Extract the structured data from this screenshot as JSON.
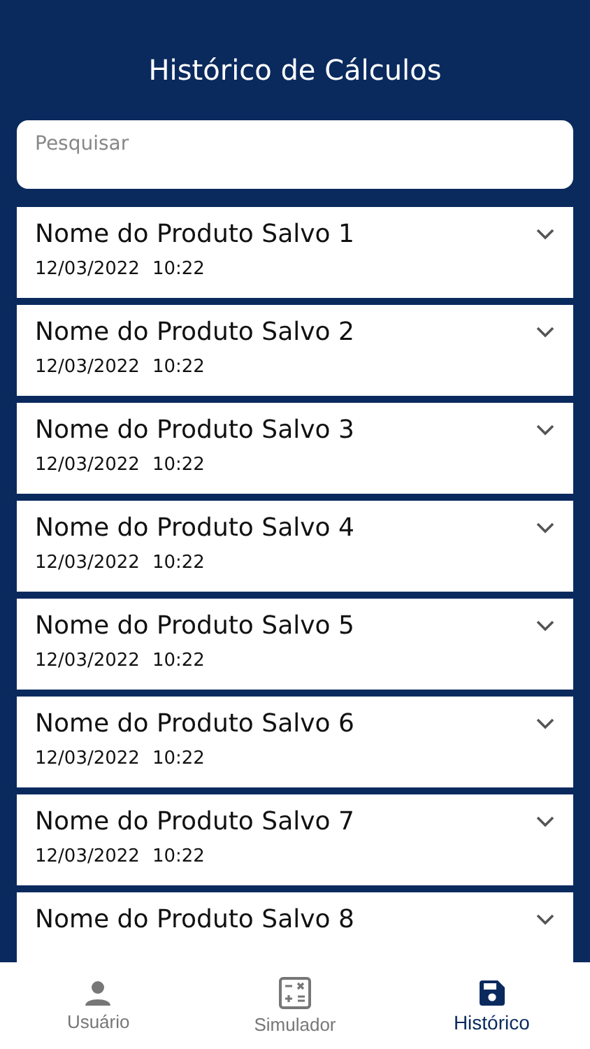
{
  "header": {
    "title": "Histórico de Cálculos"
  },
  "search": {
    "placeholder": "Pesquisar"
  },
  "items": [
    {
      "name": "Nome do Produto Salvo 1",
      "date": "12/03/2022",
      "time": "10:22",
      "expanded": false
    },
    {
      "name": "Nome do Produto Salvo 2",
      "date": "12/03/2022",
      "time": "10:22",
      "expanded": false
    },
    {
      "name": "Nome do Produto Salvo 3",
      "date": "12/03/2022",
      "time": "10:22",
      "expanded": false
    },
    {
      "name": "Nome do Produto Salvo 4",
      "date": "12/03/2022",
      "time": "10:22",
      "expanded": false
    },
    {
      "name": "Nome do Produto Salvo 5",
      "date": "12/03/2022",
      "time": "10:22",
      "expanded": false
    },
    {
      "name": "Nome do Produto Salvo 6",
      "date": "12/03/2022",
      "time": "10:22",
      "expanded": false
    },
    {
      "name": "Nome do Produto Salvo 7",
      "date": "12/03/2022",
      "time": "10:22",
      "expanded": false
    },
    {
      "name": "Nome do Produto Salvo 8",
      "expanded": false
    }
  ],
  "nav": [
    {
      "label": "Usuário",
      "kind": "user",
      "selected": false
    },
    {
      "label": "Simulador",
      "kind": "calculator",
      "selected": false
    },
    {
      "label": "Histórico",
      "kind": "save",
      "selected": true
    }
  ]
}
